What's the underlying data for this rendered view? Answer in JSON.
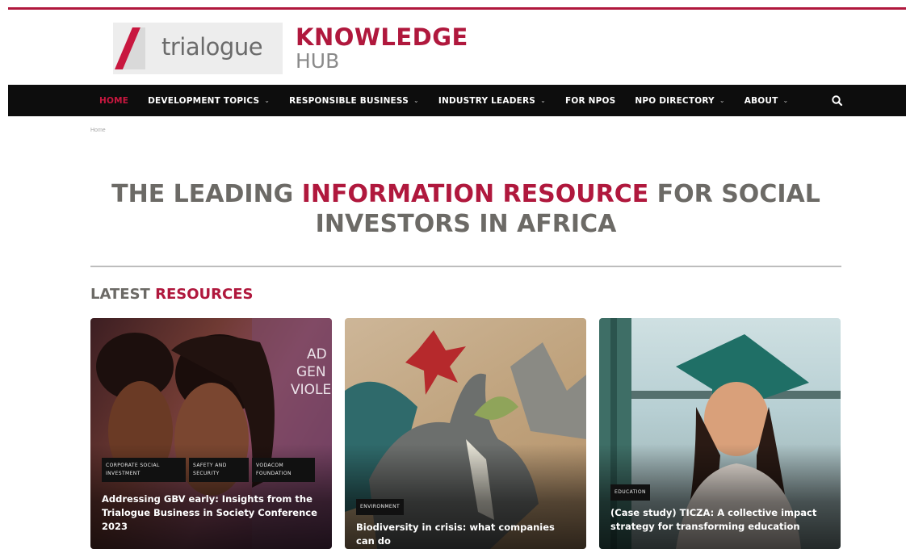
{
  "brand": {
    "logo_word": "trialogue",
    "hub_line1": "KNOWLEDGE",
    "hub_line2": "HUB",
    "accent_color": "#b0183d"
  },
  "nav": {
    "items": [
      {
        "label": "HOME",
        "active": true,
        "has_dropdown": false
      },
      {
        "label": "DEVELOPMENT TOPICS",
        "active": false,
        "has_dropdown": true
      },
      {
        "label": "RESPONSIBLE BUSINESS",
        "active": false,
        "has_dropdown": true
      },
      {
        "label": "INDUSTRY LEADERS",
        "active": false,
        "has_dropdown": true
      },
      {
        "label": "FOR NPOS",
        "active": false,
        "has_dropdown": false
      },
      {
        "label": "NPO DIRECTORY",
        "active": false,
        "has_dropdown": true
      },
      {
        "label": "ABOUT",
        "active": false,
        "has_dropdown": true
      }
    ],
    "search_icon": "search-icon",
    "dropdown_icon": "chevron-down-icon",
    "dropdown_glyph": "⌄"
  },
  "breadcrumb": "Home",
  "hero": {
    "part1": "THE LEADING ",
    "accent": "INFORMATION RESOURCE",
    "part2": " FOR SOCIAL INVESTORS IN AFRICA"
  },
  "section": {
    "part1": "LATEST ",
    "accent": "RESOURCES"
  },
  "cards": [
    {
      "tags": [
        "CORPORATE SOCIAL INVESTMENT",
        "SAFETY AND SECURITY",
        "VODACOM FOUNDATION"
      ],
      "title": "Addressing GBV early: Insights from the Trialogue Business in Society Conference 2023",
      "image_text": [
        "AD",
        "GEN",
        "VIOLE"
      ]
    },
    {
      "tags": [
        "ENVIRONMENT"
      ],
      "title": "Biodiversity in crisis: what companies can do"
    },
    {
      "tags": [
        "EDUCATION"
      ],
      "title": "(Case study) TICZA: A collective impact strategy for transforming education"
    }
  ]
}
